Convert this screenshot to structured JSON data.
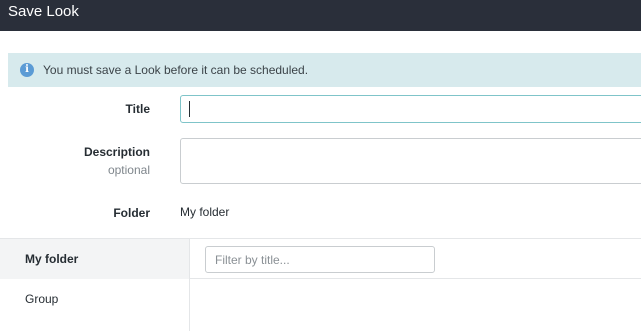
{
  "window": {
    "title": "Save Look"
  },
  "info_banner": {
    "icon": "info-icon",
    "text": "You must save a Look before it can be scheduled."
  },
  "form": {
    "title_label": "Title",
    "title_value": "",
    "description_label": "Description",
    "description_sublabel": "optional",
    "description_value": "",
    "folder_label": "Folder",
    "folder_value": "My folder"
  },
  "folder_browser": {
    "sidebar_items": [
      {
        "label": "My folder",
        "active": true
      },
      {
        "label": "Group",
        "active": false
      }
    ],
    "filter_placeholder": "Filter by title...",
    "filter_value": ""
  },
  "colors": {
    "titlebar_bg": "#2a2f3a",
    "banner_bg": "#d7eaed",
    "focus_border": "#7fc4c9",
    "info_icon": "#5b9bd5"
  }
}
